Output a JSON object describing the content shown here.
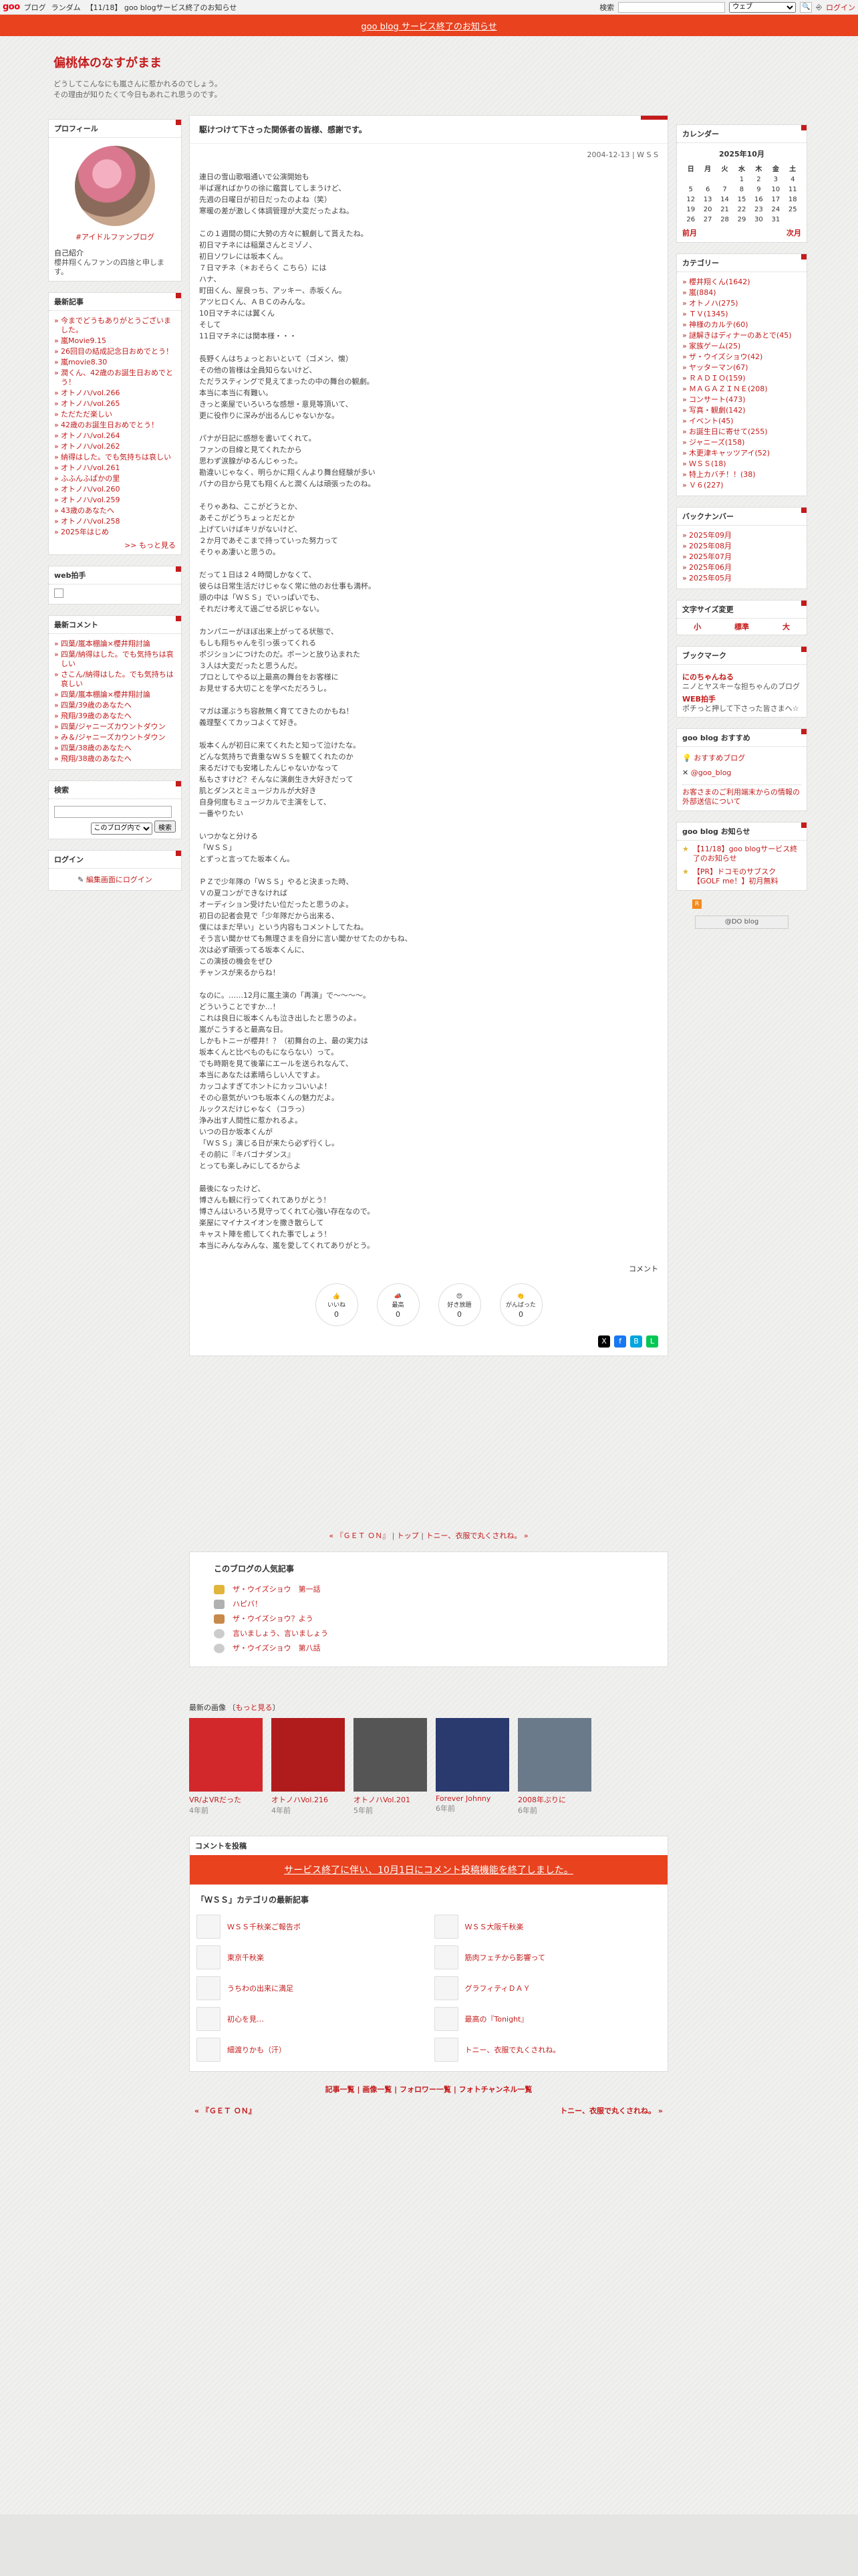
{
  "gbar": {
    "logo": "goo",
    "links": [
      "ブログ",
      "ランダム"
    ],
    "news": "【11/18】 goo blogサービス終了のお知らせ",
    "search_label": "検索",
    "search_option": "ウェブ",
    "login": "ログイン"
  },
  "notice": {
    "text": "goo blog サービス終了のお知らせ"
  },
  "header": {
    "title": "偏桃体のなすがまま",
    "desc1": "どうしてこんなにも嵐さんに惹かれるのでしょう。",
    "desc2": "その理由が知りたくて今日もあれこれ思うのです。"
  },
  "profile": {
    "title": "プロフィール",
    "name": "#アイドルファンブログ",
    "intro_label": "自己紹介",
    "intro": "櫻井翔くんファンの四捨と申します。"
  },
  "recent": {
    "title": "最新記事",
    "items": [
      "今までどうもありがとうございました。",
      "嵐Movie9.15",
      "26回目の結成記念日おめでとう！",
      "嵐movie8.30",
      "潤くん、42歳のお誕生日おめでとう！",
      "オトノハ/vol.266",
      "オトノハ/vol.265",
      "ただただ楽しい",
      "42歳のお誕生日おめでとう！",
      "オトノハ/vol.264",
      "オトノハ/vol.262",
      "納得はした。でも気持ちは哀しい",
      "オトノハ/vol.261",
      "ふふんふぱかの里",
      "オトノハ/vol.260",
      "オトノハ/vol.259",
      "43歳のあなたへ",
      "オトノハ/vol.258",
      "2025年はじめ"
    ],
    "more": ">> もっと見る"
  },
  "webclap": {
    "title": "web拍手"
  },
  "recent_comments": {
    "title": "最新コメント",
    "items": [
      "四葉/嵐本棚論×櫻井翔討論",
      "四葉/納得はした。でも気持ちは哀しい",
      "さこん/納得はした。でも気持ちは哀しい",
      "四葉/嵐本棚論×櫻井翔討論",
      "四葉/39歳のあなたへ",
      "飛翔/39歳のあなたへ",
      "四葉/ジャニーズカウントダウン",
      "み＆/ジャニーズカウントダウン",
      "四葉/38歳のあなたへ",
      "飛翔/38歳のあなたへ"
    ]
  },
  "search": {
    "title": "検索",
    "option": "このブログ内で",
    "button": "検索"
  },
  "login": {
    "title": "ログイン",
    "link": "編集画面にログイン"
  },
  "article": {
    "title": "駆けつけて下さった関係者の皆様、感謝です。",
    "meta": "2004-12-13 | W S S",
    "body": "連日の雪山歌唱通いで公演開始も\n半ば遅ればかりの徐に鑑賞してしまうけど、\n先週の日曜日が初日だったのよね（笑）\n寒暖の差が激しく体調管理が大変だったよね。\n\nこの１週間の間に大勢の方々に観劇して貰えたね。\n初日マチネには稲葉さんとミゾノ、\n初日ソワレには坂本くん。\n７日マチネ（＊おそらく こちら）には\nハナ、\n町田くん、屋良っち、アッキー、赤坂くん。\nアツヒロくん、ＡＢＣのみんな。\n10日マチネには翼くん\nそして\n11日マチネには関本様・・・\n\n長野くんはちょっとおいといて（ゴメン、懐）\nその他の皆様は全員知らないけど、\nただラスティングで見えてまったの中の舞台の観劇。\n本当に本当に有難い。\nきっと楽屋でいろいろな感想・意見等頂いて、\n更に役作りに深みが出るんじゃないかな。\n\nパナが日記に感想を書いてくれて。\nファンの目線と見てくれたから\n思わず涙腺がゆるんじゃった。\n勘違いじゃなく、明らかに翔くんより舞台経験が多い\nパナの目から見ても翔くんと潤くんは頑張ったのね。\n\nそりゃあね、ここがどうとか、\nあそこがどうちょっとだとか\n上げていけばキリがないけど、\n２か月であそこまで持っていった努力って\nそりゃあ凄いと思うの。\n\nだって１日は２４時間しかなくて、\n彼らは日常生活だけじゃなく常に他のお仕事も満杯。\n頭の中は「ＷＳＳ」でいっぱいでも、\nそれだけ考えて過ごせる訳じゃない。\n\nカンパニーがほぼ出来上がってる状態で、\nもしも翔ちゃんを引っ張ってくれる\nポジションにつけたのだ。ボーンと放り込まれた\n３人は大変だったと思うんだ。\nプロとしてやる以上最高の舞台をお客様に\nお見せする大切ことを学べただろうし。\n\nマガは運ぶうち容赦無く育ててきたのかもね！\n義理堅くてカッコよくて好き。\n\n坂本くんが初日に来てくれたと知って泣けたな。\nどんな気持ちで貴重なＷＳＳを観てくれたのか\n来るだけでも安堵したんじゃないかなって\n私もさすけど？そんなに演劇生き大好きだって\n肌とダンスとミュージカルが大好き\n自身何度もミュージカルで主演をして、\n一番やりたい\n\nいつかなと分ける\n「ＷＳＳ」\nとずっと言ってた坂本くん。\n\nＰＺで少年隊の「ＷＳＳ」やると決まった時、\nＶの夏コンができなければ\nオーディション受けたい位だったと思うのよ。\n初日の記者会見で「少年隊だから出来る、\n僕にはまだ早い」という内容もコメントしてたね。\nそう言い聞かせても無理さまを自分に言い聞かせてたのかもね、\n次は必ず頑張ってる坂本くんに、\nこの演技の機会をぜひ\nチャンスが来るからね！\n\nなのに。……12月に嵐主演の「再演」で〜〜〜〜。\nどういうことですか…！\nこれは良日に坂本くんも泣き出したと思うのよ。\n嵐がこうすると最高な日。\nしかもトニーが櫻井！？（初舞台の上、最の実力は\n坂本くんと比べものもにならない）って。\nでも時期を見て後輩にエールを送られなんて、\n本当にあなたは素晴らしい人ですよ。\nカッコよすぎてホントにカッコいいよ！\nその心意気がいつも坂本くんの魅力だよ。\nルックスだけじゃなく（コラっ）\n浄み出す人間性に惹かれるよ。\nいつの日か坂本くんが\n「ＷＳＳ」演じる日が来たら必ず行くし。\nその前に『キバゴナダンス』\nとっても楽しみにしてるからよ\n\n最後になったけど、\n博さんも観に行ってくれてありがとう！\n博さんはいろいろ見守ってくれて心強い存在なので。\n楽屋にマイナスイオンを撒き散らして\nキャスト陣を癒してくれた事でしょう！\n本当にみんなみんな、嵐を愛してくれてありがとう。",
    "comment": "コメント",
    "reactions": [
      {
        "label": "いいね",
        "count": "0"
      },
      {
        "label": "最高",
        "count": "0"
      },
      {
        "label": "好き放題",
        "count": "0"
      },
      {
        "label": "がんばった",
        "count": "0"
      }
    ]
  },
  "pager": {
    "prev": "« 『ＧＥＴ ＯＮ』",
    "top": "トップ",
    "next": "トニー、衣服で丸くされね。 »"
  },
  "popular": {
    "title": "このブログの人気記事",
    "items": [
      "ザ・ウイズショウ　第一話",
      "ハピバ！",
      "ザ・ウイズショウ？よう",
      "言いましょう、言いましょう",
      "ザ・ウイズショウ　第八話"
    ]
  },
  "images": {
    "title": "最新の画像",
    "more": "もっと見る",
    "items": [
      {
        "title": "VR/よVRだった",
        "age": "4年前",
        "color": "#d2282c"
      },
      {
        "title": "オトノハVol.216",
        "age": "4年前",
        "color": "#b01c1c"
      },
      {
        "title": "オトノハVol.201",
        "age": "5年前",
        "color": "#555555"
      },
      {
        "title": "Forever Johnny",
        "age": "6年前",
        "color": "#2a3a6e"
      },
      {
        "title": "2008年ぶりに",
        "age": "6年前",
        "color": "#6a7a8a"
      }
    ]
  },
  "post": {
    "title": "コメントを投稿",
    "end": "サービス終了に伴い、10月1日にコメント投稿機能を終了しました。"
  },
  "catnew": {
    "title": "「ＷＳＳ」カテゴリの最新記事",
    "items": [
      "ＷＳＳ千秋楽ご報告ボ",
      "ＷＳＳ大阪千秋楽",
      "東京千秋楽",
      "筋肉フェチから影響って",
      "うちわの出来に満足",
      "グラフィティＤＡＹ",
      "初心を見…",
      "最高の『Tonight』",
      "細渡りかも（汗）",
      "トニー、衣服で丸くされね。"
    ]
  },
  "footlinks": "記事一覧 | 画像一覧 | フォロワー一覧 | フォトチャンネル一覧",
  "footnav": {
    "prev": "« 『ＧＥＴ ＯＮ』",
    "next": "トニー、衣服で丸くされね。 »"
  },
  "calendar": {
    "title": "カレンダー",
    "month": "2025年10月",
    "week": [
      "日",
      "月",
      "火",
      "水",
      "木",
      "金",
      "土"
    ],
    "rows": [
      [
        "",
        "",
        "",
        "1",
        "2",
        "3",
        "4"
      ],
      [
        "5",
        "6",
        "7",
        "8",
        "9",
        "10",
        "11"
      ],
      [
        "12",
        "13",
        "14",
        "15",
        "16",
        "17",
        "18"
      ],
      [
        "19",
        "20",
        "21",
        "22",
        "23",
        "24",
        "25"
      ],
      [
        "26",
        "27",
        "28",
        "29",
        "30",
        "31",
        ""
      ]
    ],
    "prev": "前月",
    "next": "次月"
  },
  "categories": {
    "title": "カテゴリー",
    "items": [
      "櫻井翔くん(1642)",
      "嵐(884)",
      "オトノハ(275)",
      "ＴＶ(1345)",
      "神様のカルテ(60)",
      "謎解きはディナーのあとで(45)",
      "家族ゲーム(25)",
      "ザ・ウイズショウ(42)",
      "ヤッターマン(67)",
      "ＲＡＤＩＯ(159)",
      "ＭＡＧＡＺＩＮＥ(208)",
      "コンサート(473)",
      "写真・観劇(142)",
      "イベント(45)",
      "お誕生日に寄せて(255)",
      "ジャニーズ(158)",
      "木更津キャッツアイ(52)",
      "ＷＳＳ(18)",
      "特上カバチ！！(38)",
      "Ｖ６(227)"
    ]
  },
  "backnumber": {
    "title": "バックナンバー",
    "items": [
      "2025年09月",
      "2025年08月",
      "2025年07月",
      "2025年06月",
      "2025年05月"
    ]
  },
  "fontsize": {
    "title": "文字サイズ変更",
    "small": "小",
    "medium": "標準",
    "large": "大"
  },
  "bookmark": {
    "title": "ブックマーク",
    "items": [
      {
        "name": "にのちゃんねる",
        "desc": "ニノとヤスキーな担ちゃんのブログ"
      },
      {
        "name": "WEB拍手",
        "desc": "ポチっと押して下さった皆さまへ☆"
      }
    ]
  },
  "recommend": {
    "title": "goo blog おすすめ",
    "items": [
      "おすすめブログ",
      "@goo_blog"
    ],
    "note": "お客さまのご利用端末からの情報の外部送信について"
  },
  "gooinfo": {
    "title": "goo blog お知らせ",
    "items": [
      "【11/18】goo blogサービス終了のお知らせ",
      "【PR】ドコモのサブスク【GOLF me！】初月無料"
    ],
    "btn": "@DO blog"
  }
}
